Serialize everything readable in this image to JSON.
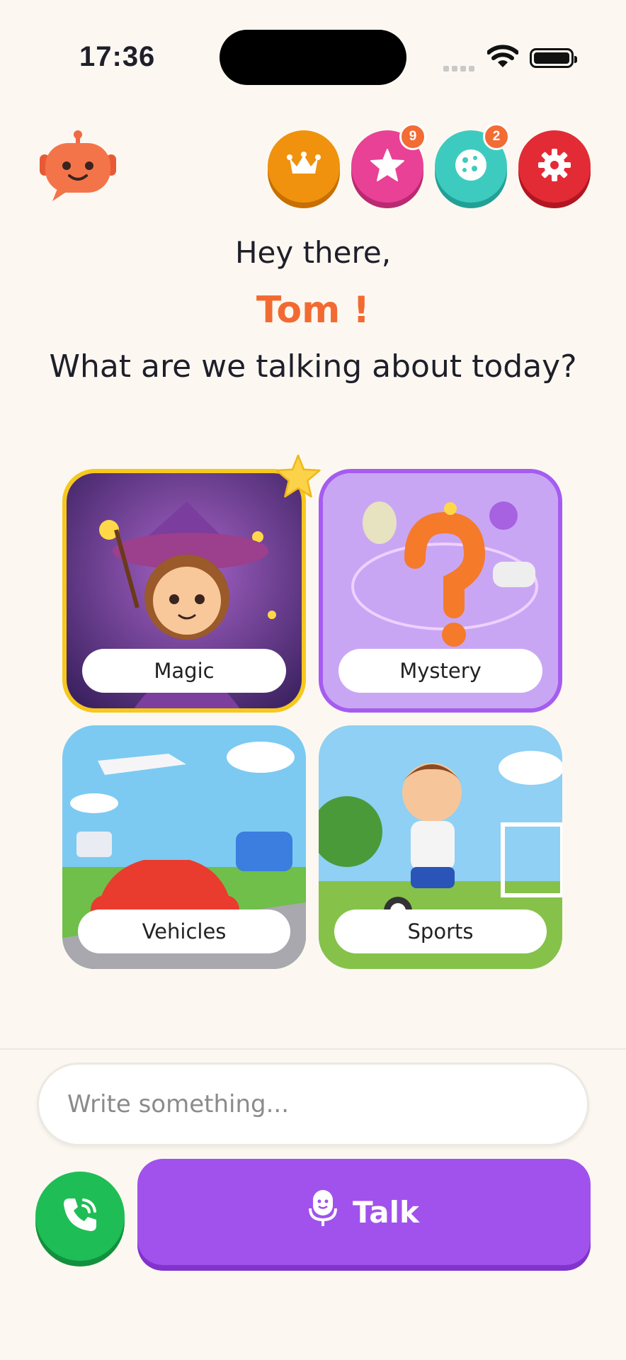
{
  "status_bar": {
    "time": "17:36"
  },
  "header": {
    "mascot_icon": "robot-chat-icon",
    "buttons": [
      {
        "name": "crown-button",
        "icon": "crown-icon",
        "color": "#f0920e",
        "badge": ""
      },
      {
        "name": "stars-button",
        "icon": "star-icon",
        "color": "#e94196",
        "badge": "9"
      },
      {
        "name": "stickers-button",
        "icon": "cookie-icon",
        "color": "#3ecbbf",
        "badge": "2"
      },
      {
        "name": "settings-button",
        "icon": "gear-icon",
        "color": "#e32b36",
        "badge": ""
      }
    ]
  },
  "greeting": {
    "line1": "Hey there,",
    "name": "Tom !",
    "line2": "What are we talking about today?"
  },
  "topics": [
    {
      "label": "Magic",
      "selected": true
    },
    {
      "label": "Mystery",
      "selected": false
    },
    {
      "label": "Vehicles",
      "selected": false
    },
    {
      "label": "Sports",
      "selected": false
    }
  ],
  "composer": {
    "placeholder": "Write something...",
    "value": "",
    "talk_label": "Talk",
    "call_icon": "phone-call-icon",
    "mic_icon": "microphone-icon"
  },
  "colors": {
    "background": "#fcf8f1",
    "accent_orange": "#f26a32",
    "talk_purple": "#a152ec",
    "call_green": "#1fbd55",
    "selected_border": "#f7c81c"
  }
}
